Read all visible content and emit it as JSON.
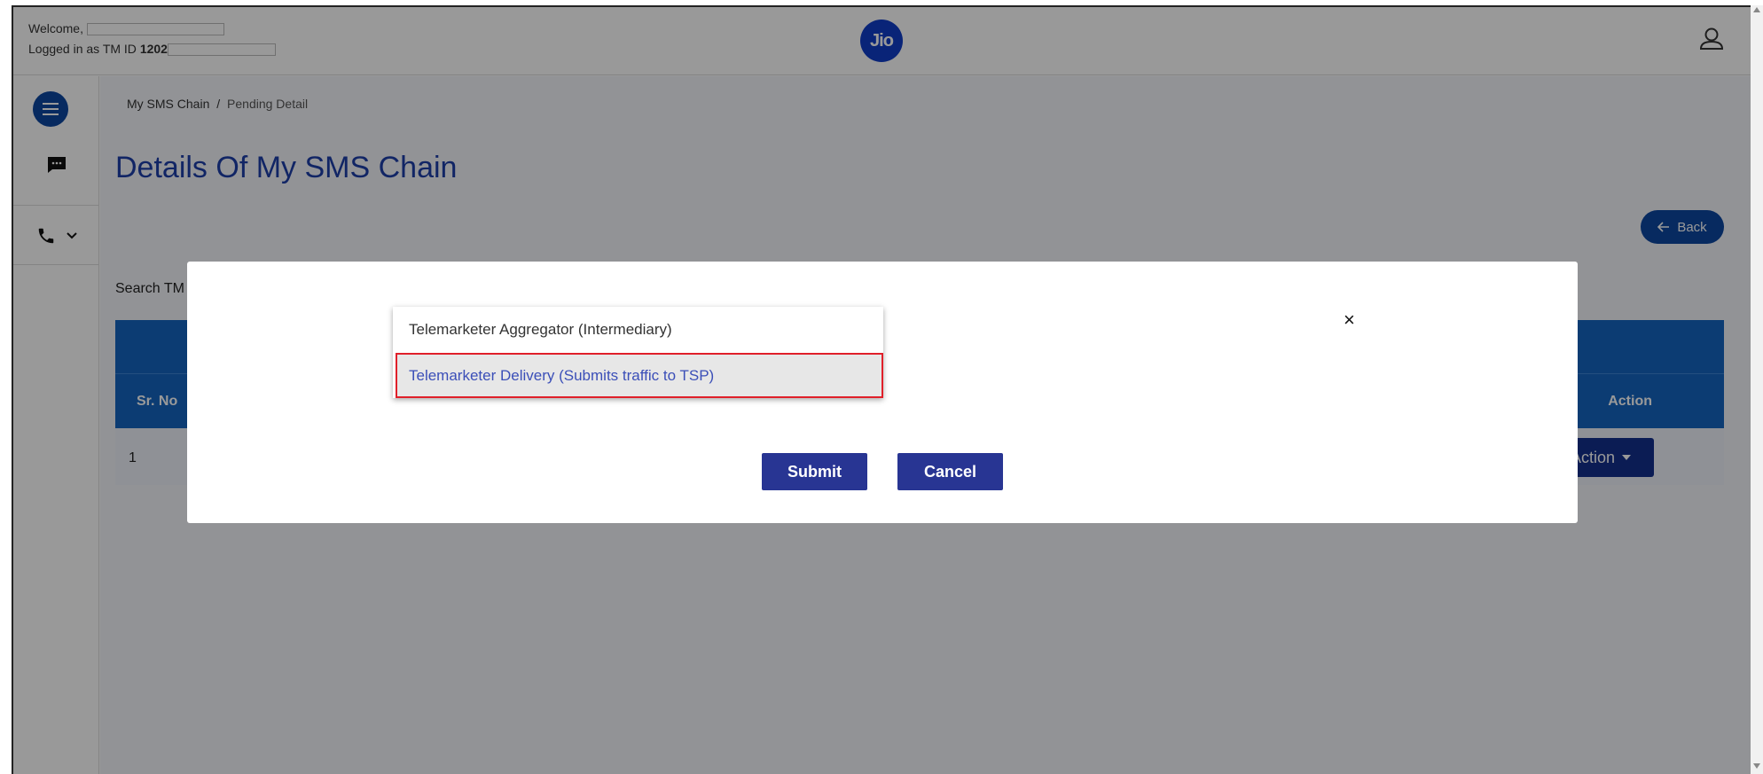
{
  "header": {
    "welcome_text": "Welcome,",
    "logged_in_text": "Logged in as TM ID",
    "tm_id_prefix": "1202",
    "logo_text": "Jio"
  },
  "breadcrumb": {
    "parent": "My SMS Chain",
    "separator": "/",
    "current": "Pending Detail"
  },
  "page": {
    "title": "Details Of My SMS Chain",
    "back_label": "Back",
    "search_label": "Search TM"
  },
  "table": {
    "headers": {
      "sr_no": "Sr. No",
      "action": "Action"
    },
    "rows": [
      {
        "sr_no": "1",
        "action_label": "Action"
      }
    ]
  },
  "modal": {
    "close_symbol": "×",
    "options": [
      "Telemarketer Aggregator (Intermediary)",
      "Telemarketer Delivery (Submits traffic to TSP)"
    ],
    "submit_label": "Submit",
    "cancel_label": "Cancel"
  },
  "colors": {
    "primary": "#0d47a1",
    "button": "#283593",
    "highlight_border": "#e0202a",
    "title": "#1d3ea8"
  }
}
